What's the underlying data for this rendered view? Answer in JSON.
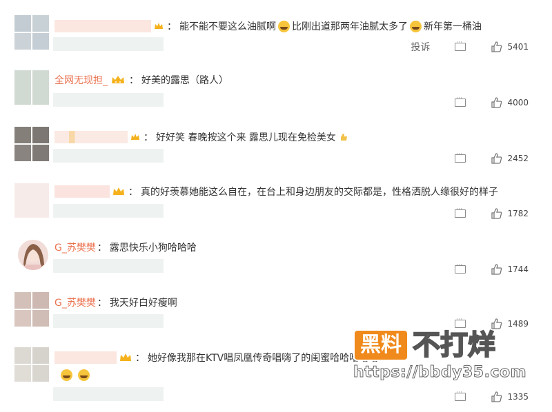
{
  "comments": [
    {
      "user": "",
      "text": "能不能不要这么油腻啊",
      "text2": "比刚出道那两年油腻太多了",
      "text3": "新年第一桶油",
      "report": "投诉",
      "likes": "5401"
    },
    {
      "user": "全网无现担_",
      "text": "好美的露思（路人）",
      "likes": "4000"
    },
    {
      "user": "",
      "text": "好好笑 春晚按这个来 露思儿现在免检美女",
      "likes": "2452"
    },
    {
      "user": "",
      "text": "真的好羡慕她能这么自在，在台上和身边朋友的交际都是，性格洒脱人缘很好的样子",
      "likes": "1782"
    },
    {
      "user": "G_苏樊樊",
      "text": "露思快乐小狗哈哈哈",
      "likes": "1744"
    },
    {
      "user": "G_苏樊樊",
      "text": "我天好白好瘦啊",
      "likes": "1489"
    },
    {
      "user": "",
      "text": "她好像我那在KTV唱凤凰传奇唱嗨了的闺蜜哈哈哈哈哈",
      "likes": "1335"
    }
  ],
  "watermark": {
    "brand_box": "黑料",
    "brand_big": "不打烊",
    "url": "https://bbdy35.com"
  },
  "colors": {
    "username": "#eb7350",
    "crown": "#f5b21c",
    "watermark_orange": "#f08a1c"
  },
  "icons": {
    "crown": "crown-icon",
    "comment": "comment-icon",
    "like": "thumbs-up-icon",
    "emoji": "laughing-emoji-icon"
  }
}
